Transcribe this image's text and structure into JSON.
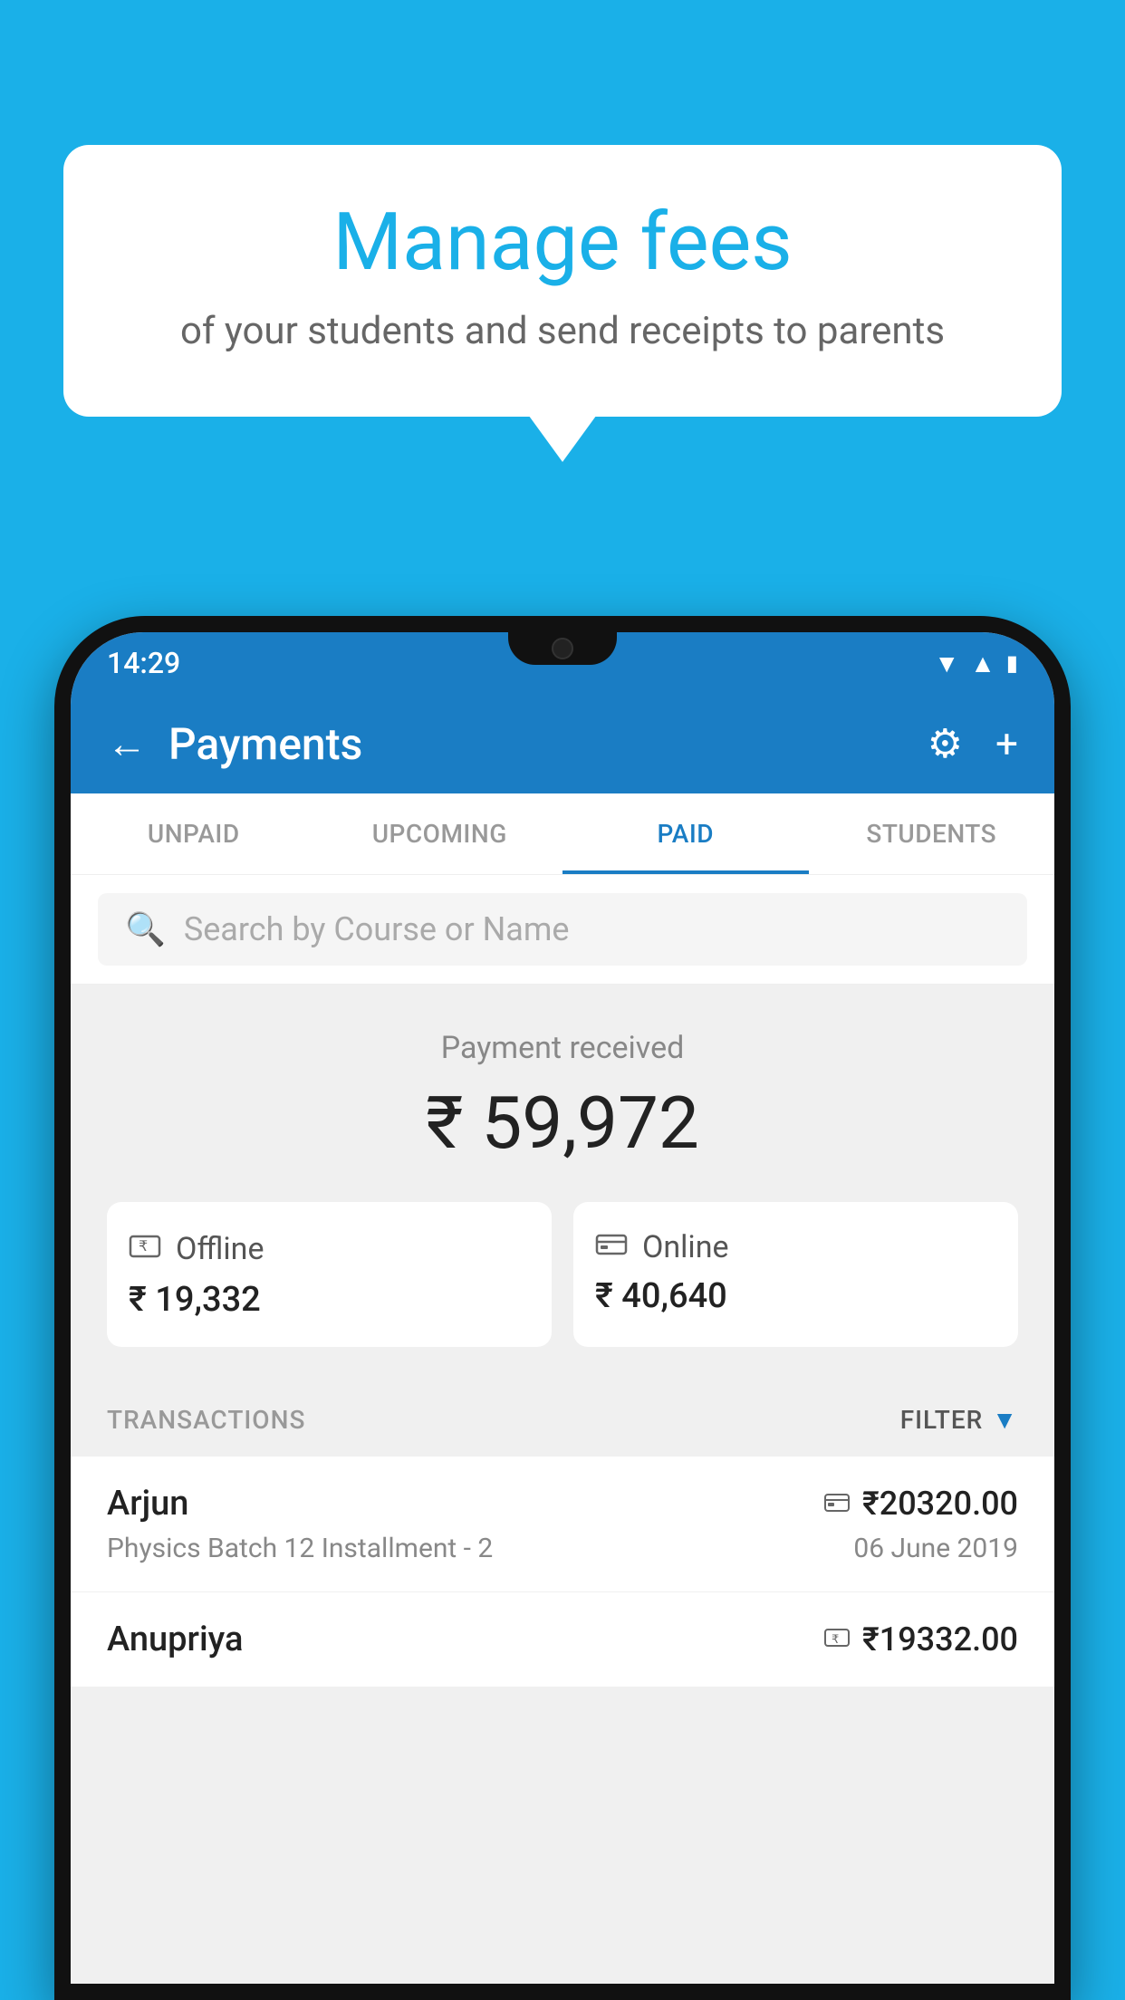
{
  "background_color": "#1ab0e8",
  "speech_bubble": {
    "title": "Manage fees",
    "subtitle": "of your students and send receipts to parents"
  },
  "status_bar": {
    "time": "14:29",
    "wifi_icon": "▾",
    "signal_icon": "▾",
    "battery_icon": "▮"
  },
  "app_bar": {
    "title": "Payments",
    "back_label": "←",
    "settings_icon": "⚙",
    "add_icon": "+"
  },
  "tabs": [
    {
      "label": "UNPAID",
      "active": false
    },
    {
      "label": "UPCOMING",
      "active": false
    },
    {
      "label": "PAID",
      "active": true
    },
    {
      "label": "STUDENTS",
      "active": false
    }
  ],
  "search": {
    "placeholder": "Search by Course or Name"
  },
  "payment_summary": {
    "received_label": "Payment received",
    "total_amount": "₹ 59,972",
    "offline_label": "Offline",
    "offline_amount": "₹ 19,332",
    "online_label": "Online",
    "online_amount": "₹ 40,640"
  },
  "transactions": {
    "header_label": "TRANSACTIONS",
    "filter_label": "FILTER",
    "items": [
      {
        "name": "Arjun",
        "detail": "Physics Batch 12 Installment - 2",
        "amount": "₹20320.00",
        "date": "06 June 2019",
        "payment_type": "online"
      },
      {
        "name": "Anupriya",
        "detail": "",
        "amount": "₹19332.00",
        "date": "",
        "payment_type": "offline"
      }
    ]
  }
}
